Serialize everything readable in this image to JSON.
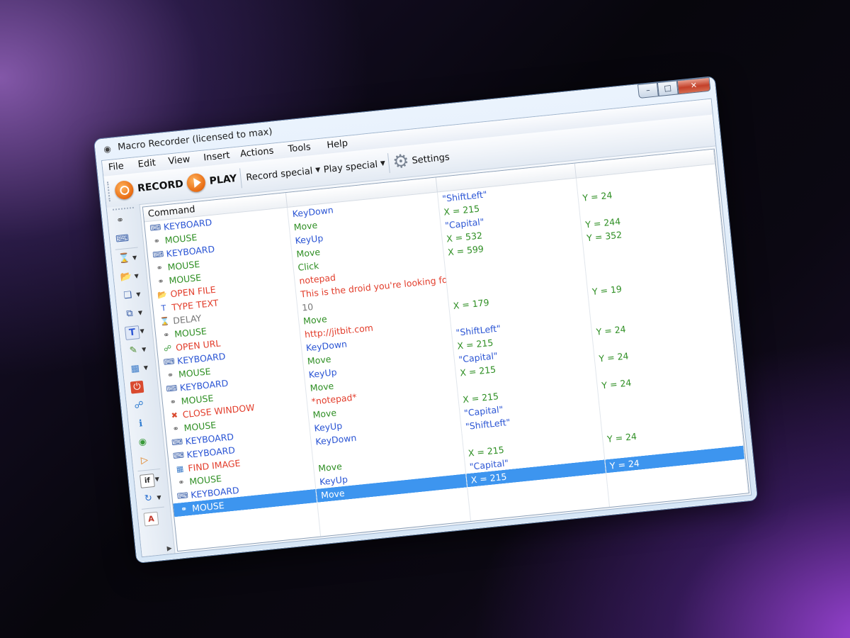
{
  "window": {
    "title": "Macro Recorder (licensed to max)"
  },
  "menu": [
    "File",
    "Edit",
    "View",
    "Insert",
    "Actions",
    "Tools",
    "Help"
  ],
  "toolbar": {
    "record": "RECORD",
    "play": "PLAY",
    "record_special": "Record special",
    "play_special": "Play special",
    "settings": "Settings"
  },
  "sidebar_icons": [
    "mouse-icon",
    "keyboard-icon",
    "hourglass-icon",
    "open-file-icon",
    "window-icon",
    "copy-icon",
    "type-text-icon",
    "pencil-icon",
    "image-icon",
    "power-icon",
    "open-url-icon",
    "info-icon",
    "globe-icon",
    "play-icon",
    "if-icon",
    "loop-icon",
    "text-icon"
  ],
  "colors": {
    "keyboard": "#2b55d4",
    "mouse": "#2f8f24",
    "action": "#e23d2b",
    "delay": "#777777",
    "selection": "#3d95ef"
  },
  "grid": {
    "header": "Command",
    "rows": [
      {
        "cmd": "KEYBOARD",
        "icon": "keyboard-icon",
        "kind": "key",
        "p1": "KeyDown",
        "p2": "\"ShiftLeft\"",
        "p3": ""
      },
      {
        "cmd": "MOUSE",
        "icon": "mouse-icon",
        "kind": "mouse",
        "p1": "Move",
        "p2": "X = 215",
        "p3": "Y = 24"
      },
      {
        "cmd": "KEYBOARD",
        "icon": "keyboard-icon",
        "kind": "key",
        "p1": "KeyUp",
        "p2": "\"Capital\"",
        "p3": ""
      },
      {
        "cmd": "MOUSE",
        "icon": "mouse-icon",
        "kind": "mouse",
        "p1": "Move",
        "p2": "X = 532",
        "p3": "Y = 244"
      },
      {
        "cmd": "MOUSE",
        "icon": "mouse-icon",
        "kind": "mouse",
        "p1": "Click",
        "p2": "X = 599",
        "p3": "Y = 352"
      },
      {
        "cmd": "OPEN FILE",
        "icon": "open-file-icon",
        "kind": "red",
        "p1": "notepad",
        "p2": "",
        "p3": ""
      },
      {
        "cmd": "TYPE TEXT",
        "icon": "type-text-icon",
        "kind": "red",
        "p1": "This is the droid you're looking for!",
        "p2": "",
        "p3": ""
      },
      {
        "cmd": "DELAY",
        "icon": "hourglass-icon",
        "kind": "gray",
        "p1": "10",
        "p2": "",
        "p3": ""
      },
      {
        "cmd": "MOUSE",
        "icon": "mouse-icon",
        "kind": "mouse",
        "p1": "Move",
        "p2": "X = 179",
        "p3": "Y = 19"
      },
      {
        "cmd": "OPEN URL",
        "icon": "open-url-icon",
        "kind": "red",
        "p1": "http://jitbit.com",
        "p2": "",
        "p3": ""
      },
      {
        "cmd": "KEYBOARD",
        "icon": "keyboard-icon",
        "kind": "key",
        "p1": "KeyDown",
        "p2": "\"ShiftLeft\"",
        "p3": ""
      },
      {
        "cmd": "MOUSE",
        "icon": "mouse-icon",
        "kind": "mouse",
        "p1": "Move",
        "p2": "X = 215",
        "p3": "Y = 24"
      },
      {
        "cmd": "KEYBOARD",
        "icon": "keyboard-icon",
        "kind": "key",
        "p1": "KeyUp",
        "p2": "\"Capital\"",
        "p3": ""
      },
      {
        "cmd": "MOUSE",
        "icon": "mouse-icon",
        "kind": "mouse",
        "p1": "Move",
        "p2": "X = 215",
        "p3": "Y = 24"
      },
      {
        "cmd": "CLOSE WINDOW",
        "icon": "close-window-icon",
        "kind": "red",
        "p1": "*notepad*",
        "p2": "",
        "p3": ""
      },
      {
        "cmd": "MOUSE",
        "icon": "mouse-icon",
        "kind": "mouse",
        "p1": "Move",
        "p2": "X = 215",
        "p3": "Y = 24"
      },
      {
        "cmd": "KEYBOARD",
        "icon": "keyboard-icon",
        "kind": "key",
        "p1": "KeyUp",
        "p2": "\"Capital\"",
        "p3": ""
      },
      {
        "cmd": "KEYBOARD",
        "icon": "keyboard-icon",
        "kind": "key",
        "p1": "KeyDown",
        "p2": "\"ShiftLeft\"",
        "p3": ""
      },
      {
        "cmd": "FIND IMAGE",
        "icon": "image-icon",
        "kind": "red",
        "p1": "",
        "p2": "",
        "p3": ""
      },
      {
        "cmd": "MOUSE",
        "icon": "mouse-icon",
        "kind": "mouse",
        "p1": "Move",
        "p2": "X = 215",
        "p3": "Y = 24"
      },
      {
        "cmd": "KEYBOARD",
        "icon": "keyboard-icon",
        "kind": "key",
        "p1": "KeyUp",
        "p2": "\"Capital\"",
        "p3": ""
      },
      {
        "cmd": "MOUSE",
        "icon": "mouse-icon",
        "kind": "mouse",
        "p1": "Move",
        "p2": "X = 215",
        "p3": "Y = 24",
        "selected": true
      }
    ]
  }
}
